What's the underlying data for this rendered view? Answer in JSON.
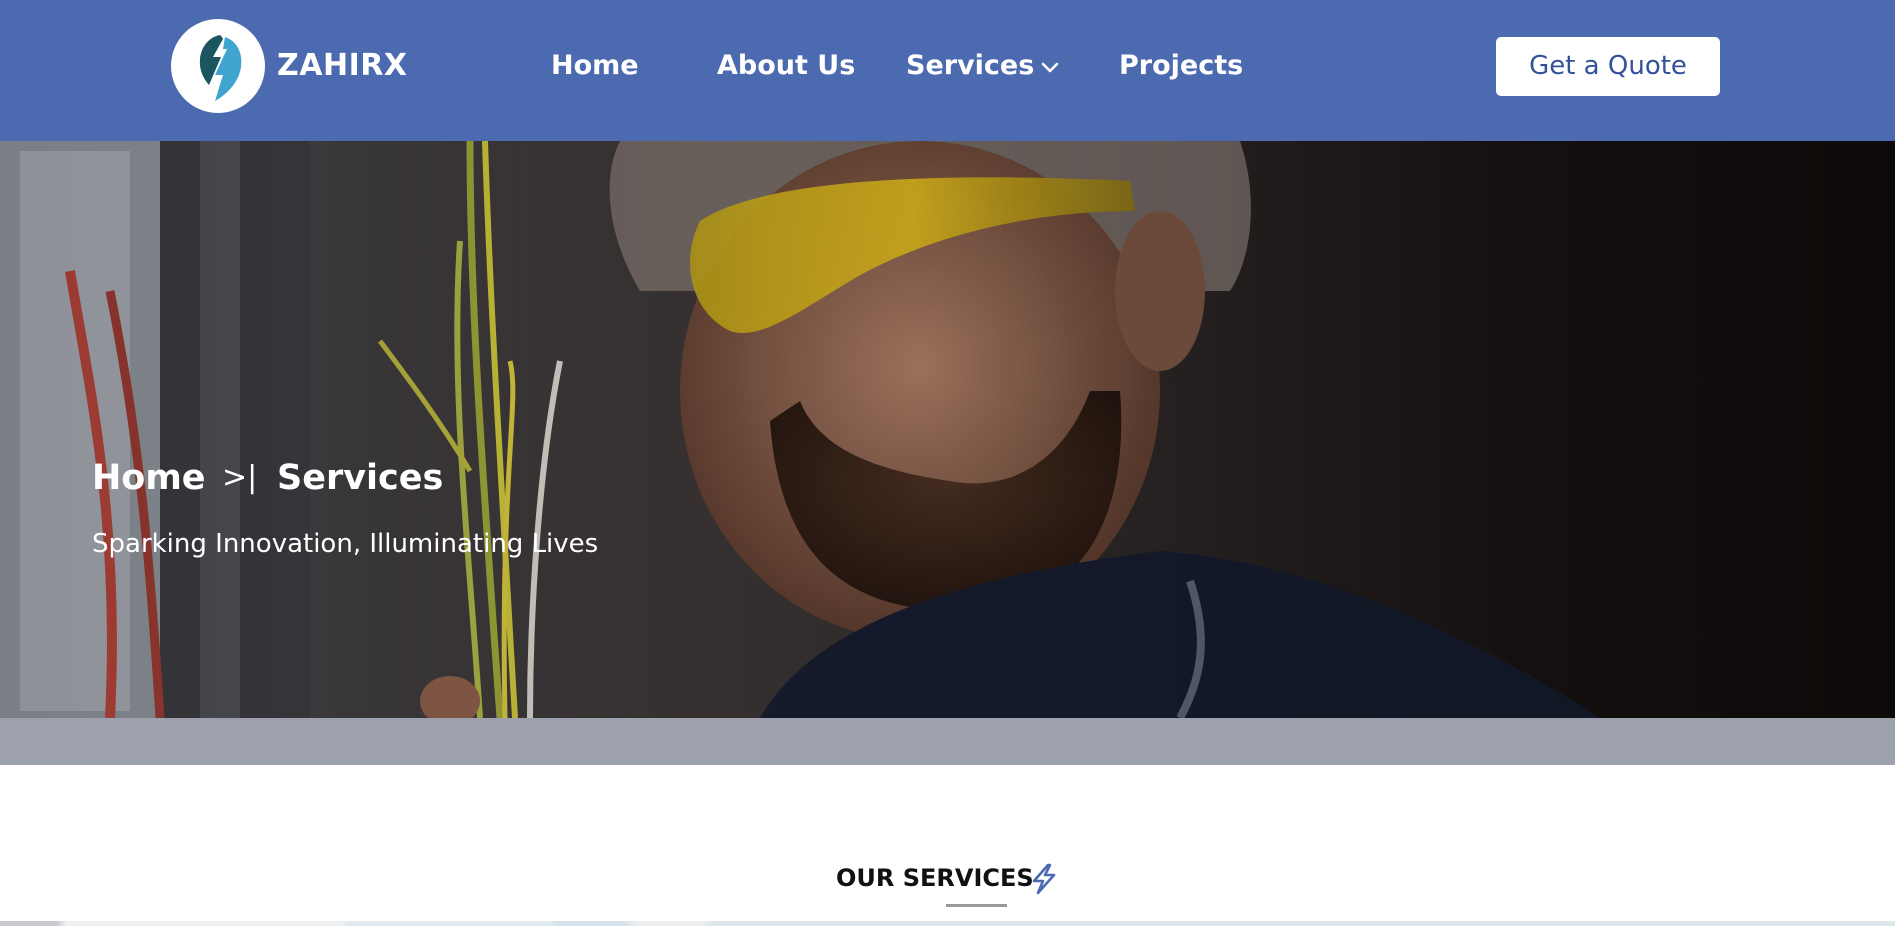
{
  "colors": {
    "header_bg": "#4c6aaf",
    "quote_text": "#34519c",
    "logo_bolt_dark": "#1b5560",
    "logo_bolt_light": "#3fa5cf",
    "section_bolt": "#4c6aaf"
  },
  "brand": {
    "logo_icon": "lightning-bolt-icon",
    "name": "ZAHIRX"
  },
  "nav": {
    "items": [
      {
        "label": "Home"
      },
      {
        "label": "About Us"
      },
      {
        "label": "Services",
        "icon": "chevron-down-icon"
      },
      {
        "label": "Projects"
      }
    ],
    "cta_label": "Get a Quote"
  },
  "hero": {
    "breadcrumb": {
      "home": "Home",
      "separator": ">|",
      "current": "Services"
    },
    "tagline": "Sparking Innovation, Illuminating Lives"
  },
  "section": {
    "title": "OUR SERVICES",
    "icon": "lightning-bolt-icon"
  }
}
